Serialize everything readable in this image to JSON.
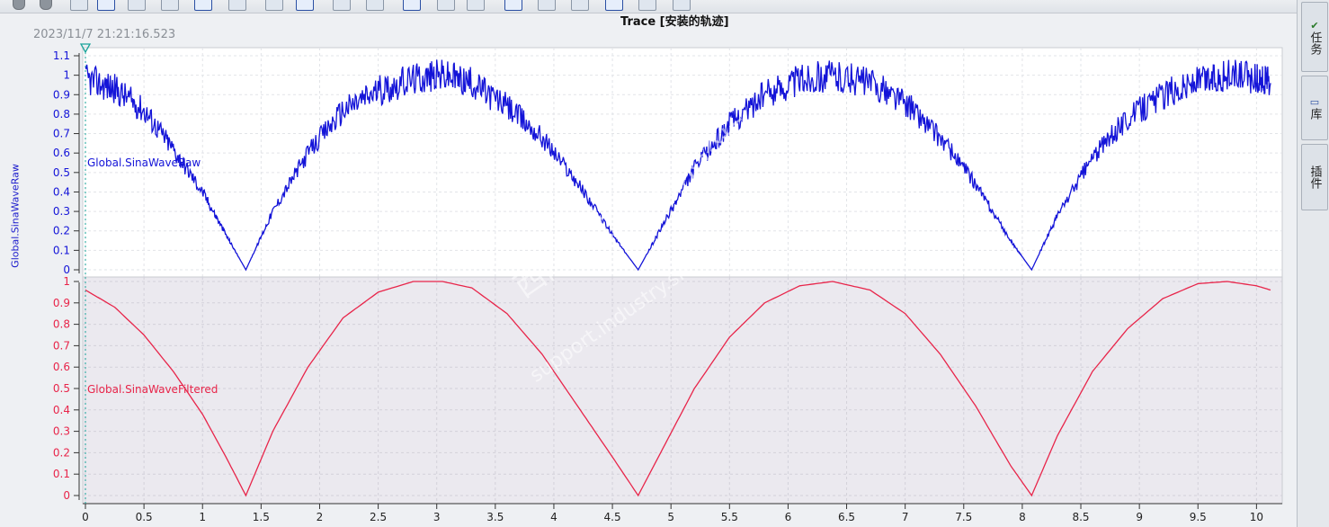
{
  "trace_view": {
    "title": "Trace [安装的轨迹]",
    "timestamp": "2023/11/7 21:21:16.523",
    "y_axis_title": "Global.SinaWaveRaw",
    "watermark_line1": "西门子工业  技术论坛",
    "watermark_line2": "support.industry.siemens.com/cs"
  },
  "toolbar": {
    "buttons": [
      "back-icon",
      "forward-icon",
      "pin-icon",
      "hand-icon",
      "zoom-in-icon",
      "zoom-out-icon",
      "zoom-area-icon",
      "zoom-x-icon",
      "zoom-y-icon",
      "zoom-100-x-icon",
      "zoom-100-y-icon",
      "snapshot-icon",
      "measure-icon",
      "cursor-x-icon",
      "cursor-y-icon",
      "stack-icon",
      "layout-icon",
      "legend-icon",
      "grid-icon",
      "list-icon",
      "color-icon"
    ]
  },
  "right_panel": {
    "tabs": [
      {
        "label": "任务",
        "icon": "task-icon"
      },
      {
        "label": "库",
        "icon": "library-icon"
      },
      {
        "label": "插件",
        "icon": ""
      }
    ]
  },
  "colors": {
    "raw": "#1414d8",
    "filtered": "#e8254a",
    "upper_bg": "#ffffff",
    "lower_bg": "#ebe9ef"
  },
  "chart_data": {
    "type": "line",
    "x_ticks": [
      "0",
      "0.5",
      "1",
      "1.5",
      "2",
      "2.5",
      "3",
      "3.5",
      "4",
      "4.5",
      "5",
      "5.5",
      "6",
      "6.5",
      "7",
      "7.5",
      "8",
      "8.5",
      "9",
      "9.5",
      "10"
    ],
    "xlim": [
      0,
      10.12
    ],
    "panels": [
      {
        "label": "Global.SinaWaveRaw",
        "ylim": [
          0,
          1.1
        ],
        "y_ticks": [
          "0",
          "0.1",
          "0.2",
          "0.3",
          "0.4",
          "0.5",
          "0.6",
          "0.7",
          "0.8",
          "0.9",
          "1",
          "1.1"
        ],
        "series": {
          "x": [
            0,
            0.25,
            0.5,
            0.75,
            1.0,
            1.2,
            1.37,
            1.6,
            1.9,
            2.2,
            2.5,
            2.8,
            3.05,
            3.3,
            3.6,
            3.9,
            4.2,
            4.5,
            4.72,
            4.95,
            5.2,
            5.5,
            5.8,
            6.1,
            6.38,
            6.7,
            7.0,
            7.3,
            7.6,
            7.9,
            8.08,
            8.3,
            8.6,
            8.9,
            9.2,
            9.5,
            9.75,
            10.0,
            10.12
          ],
          "y": [
            0.98,
            0.93,
            0.82,
            0.62,
            0.4,
            0.18,
            0.0,
            0.3,
            0.6,
            0.82,
            0.92,
            0.98,
            1.0,
            0.96,
            0.84,
            0.68,
            0.45,
            0.18,
            0.0,
            0.25,
            0.52,
            0.75,
            0.9,
            0.98,
            1.0,
            0.96,
            0.86,
            0.68,
            0.44,
            0.15,
            0.0,
            0.28,
            0.58,
            0.78,
            0.9,
            0.97,
            1.0,
            0.98,
            0.96
          ],
          "noisy": true
        }
      },
      {
        "label": "Global.SinaWaveFiltered",
        "ylim": [
          0,
          1
        ],
        "y_ticks": [
          "0",
          "0.1",
          "0.2",
          "0.3",
          "0.4",
          "0.5",
          "0.6",
          "0.7",
          "0.8",
          "0.9",
          "1"
        ],
        "series": {
          "x": [
            0,
            0.25,
            0.5,
            0.75,
            1.0,
            1.2,
            1.37,
            1.6,
            1.9,
            2.2,
            2.5,
            2.8,
            3.05,
            3.3,
            3.6,
            3.9,
            4.2,
            4.5,
            4.72,
            4.95,
            5.2,
            5.5,
            5.8,
            6.1,
            6.38,
            6.7,
            7.0,
            7.3,
            7.6,
            7.9,
            8.08,
            8.3,
            8.6,
            8.9,
            9.2,
            9.5,
            9.75,
            10.0,
            10.12
          ],
          "y": [
            0.96,
            0.88,
            0.75,
            0.58,
            0.38,
            0.18,
            0.0,
            0.3,
            0.6,
            0.83,
            0.95,
            1.0,
            1.0,
            0.97,
            0.85,
            0.66,
            0.42,
            0.18,
            0.0,
            0.24,
            0.5,
            0.74,
            0.9,
            0.98,
            1.0,
            0.96,
            0.85,
            0.66,
            0.42,
            0.14,
            0.0,
            0.28,
            0.58,
            0.78,
            0.92,
            0.99,
            1.0,
            0.98,
            0.96
          ],
          "noisy": false
        }
      }
    ]
  }
}
